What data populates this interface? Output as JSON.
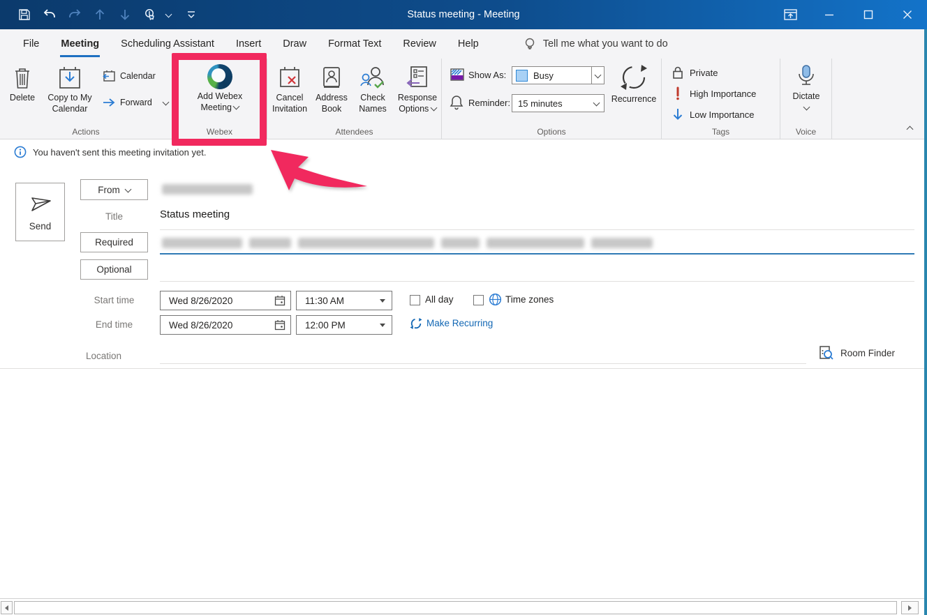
{
  "window": {
    "title": "Status meeting  -  Meeting"
  },
  "tabs": {
    "items": [
      "File",
      "Meeting",
      "Scheduling Assistant",
      "Insert",
      "Draw",
      "Format Text",
      "Review",
      "Help"
    ],
    "selected": "Meeting",
    "tell_me": "Tell me what you want to do"
  },
  "ribbon": {
    "actions": {
      "label": "Actions",
      "delete": "Delete",
      "copy": "Copy to My Calendar",
      "calendar": "Calendar",
      "forward": "Forward"
    },
    "webex": {
      "label": "Webex",
      "add_line1": "Add Webex",
      "add_line2": "Meeting"
    },
    "attendees": {
      "label": "Attendees",
      "cancel1": "Cancel",
      "cancel2": "Invitation",
      "address1": "Address",
      "address2": "Book",
      "check1": "Check",
      "check2": "Names",
      "response1": "Response",
      "response2": "Options"
    },
    "options": {
      "label": "Options",
      "show_as": "Show As:",
      "show_as_value": "Busy",
      "reminder": "Reminder:",
      "reminder_value": "15 minutes",
      "recurrence": "Recurrence"
    },
    "tags": {
      "label": "Tags",
      "private": "Private",
      "high": "High Importance",
      "low": "Low Importance"
    },
    "voice": {
      "label": "Voice",
      "dictate": "Dictate"
    }
  },
  "infobar": {
    "message": "You haven't sent this meeting invitation yet."
  },
  "form": {
    "send": "Send",
    "from": "From",
    "title_label": "Title",
    "title_value": "Status meeting",
    "required": "Required",
    "optional": "Optional",
    "start_label": "Start time",
    "end_label": "End time",
    "start_date": "Wed 8/26/2020",
    "start_time": "11:30 AM",
    "end_date": "Wed 8/26/2020",
    "end_time": "12:00 PM",
    "all_day": "All day",
    "time_zones": "Time zones",
    "make_recurring": "Make Recurring",
    "location_label": "Location",
    "room_finder": "Room Finder"
  },
  "colors": {
    "titlebar_gradient_left": "#0b3a6c",
    "titlebar_gradient_right": "#1373c9",
    "ribbon_background": "#f4f4f6",
    "tab_accent_blue": "#1e70c1",
    "highlight_pink": "#f1295e",
    "link_blue": "#1267b4",
    "busy_fill": "#a9d1f5",
    "required_underline": "#2f7ab5",
    "webex_green": "#57b148",
    "webex_navy": "#0d3a5e"
  }
}
